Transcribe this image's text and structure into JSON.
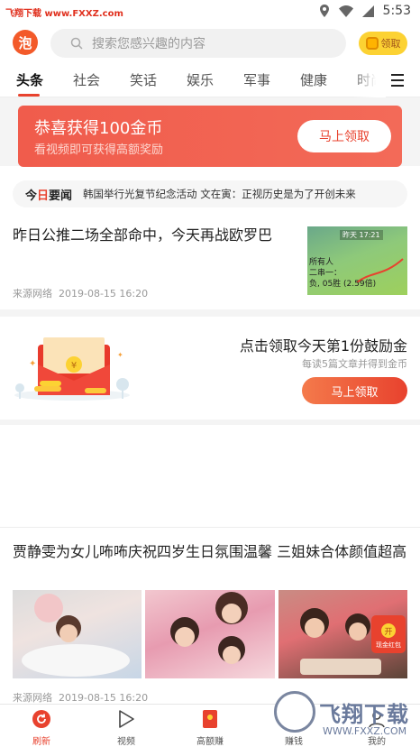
{
  "status_bar": {
    "watermark_text": "飞翔下载 www.FXXZ.com",
    "time": "5:53"
  },
  "header": {
    "logo_glyph": "泡",
    "search_placeholder": "搜索您感兴趣的内容",
    "coin_label": "领取"
  },
  "tabs": [
    {
      "label": "头条",
      "active": true
    },
    {
      "label": "社会",
      "active": false
    },
    {
      "label": "笑话",
      "active": false
    },
    {
      "label": "娱乐",
      "active": false
    },
    {
      "label": "军事",
      "active": false
    },
    {
      "label": "健康",
      "active": false
    },
    {
      "label": "时尚",
      "active": false
    }
  ],
  "banner": {
    "title": "恭喜获得100金币",
    "subtitle": "看视频即可获得高额奖励",
    "button": "马上领取"
  },
  "ticker": {
    "label_prefix": "今",
    "label_red": "日",
    "label_suffix": "要闻",
    "text": "韩国举行光复节纪念活动 文在寅：正视历史是为了开创未来"
  },
  "article_1": {
    "title": "昨日公推二场全部命中，今天再战欧罗巴",
    "source": "来源网络",
    "date": "2019-08-15 16:20",
    "thumb_text_1": "昨天 17:21",
    "thumb_text_2": "所有人",
    "thumb_text_3": "二串一：",
    "thumb_text_4": "负, 05胜 (2.59倍)"
  },
  "reward_card": {
    "title": "点击领取今天第1份鼓励金",
    "subtitle": "每读5篇文章并得到金币",
    "button": "马上领取"
  },
  "article_2": {
    "title": "贾静雯为女儿咘咘庆祝四岁生日氛围温馨 三姐妹合体颜值超高",
    "source": "来源网络",
    "date": "2019-08-15 16:20"
  },
  "cash_badge": {
    "open_glyph": "开",
    "label": "现金红包"
  },
  "bottom_nav": [
    {
      "label": "刷新",
      "active": true,
      "icon": "refresh-icon"
    },
    {
      "label": "视频",
      "active": false,
      "icon": "play-icon"
    },
    {
      "label": "高额赚",
      "active": false,
      "icon": "red-envelope-icon"
    },
    {
      "label": "赚钱",
      "active": false,
      "icon": "coin-icon"
    },
    {
      "label": "我的",
      "active": false,
      "icon": "user-icon"
    }
  ],
  "site_watermark": {
    "big": "飞翔下载",
    "small": "WWW.FXXZ.COM"
  },
  "colors": {
    "accent": "#e8422e",
    "banner": "#f05c4c",
    "coin": "#fcd233"
  }
}
